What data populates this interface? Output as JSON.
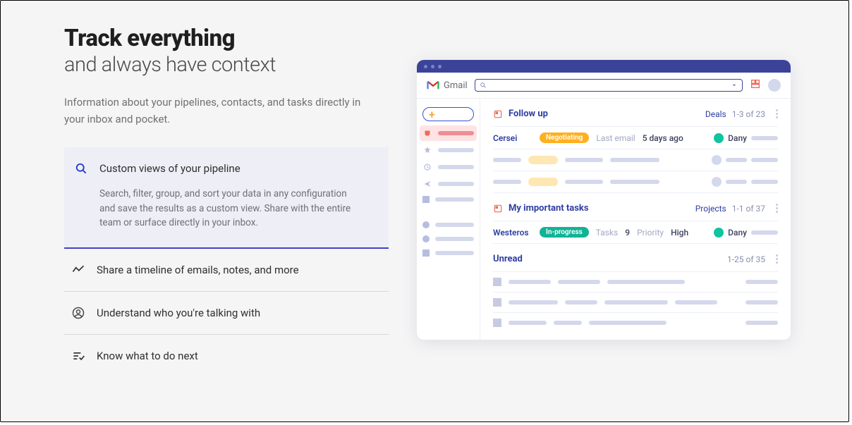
{
  "headline": "Track everything",
  "subheadline": "and always have context",
  "lede": "Information about your pipelines, contacts, and tasks directly in your inbox and pocket.",
  "features": {
    "pipeline": {
      "title": "Custom views of your pipeline",
      "body": "Search, filter, group, and sort your data in any configuration and save the results as a custom view. Share with the entire team or surface directly in your inbox."
    },
    "timeline": {
      "title": "Share a timeline of emails, notes, and more"
    },
    "understand": {
      "title": "Understand who you're talking with"
    },
    "todo": {
      "title": "Know what to do next"
    }
  },
  "app": {
    "product": "Gmail",
    "sections": {
      "follow_up": {
        "title": "Follow up",
        "scope": "Deals",
        "range": "1-3 of 23",
        "rows": [
          {
            "name": "Cersei",
            "badge": "Negotiating",
            "label": "Last email",
            "value": "5 days ago",
            "assignee": "Dany"
          }
        ]
      },
      "tasks": {
        "title": "My important tasks",
        "scope": "Projects",
        "range": "1-1 of 37",
        "rows": [
          {
            "name": "Westeros",
            "badge": "In-progress",
            "label1": "Tasks",
            "value1": "9",
            "label2": "Priority",
            "value2": "High",
            "assignee": "Dany"
          }
        ]
      },
      "unread": {
        "title": "Unread",
        "range": "1-25 of 35"
      }
    }
  }
}
